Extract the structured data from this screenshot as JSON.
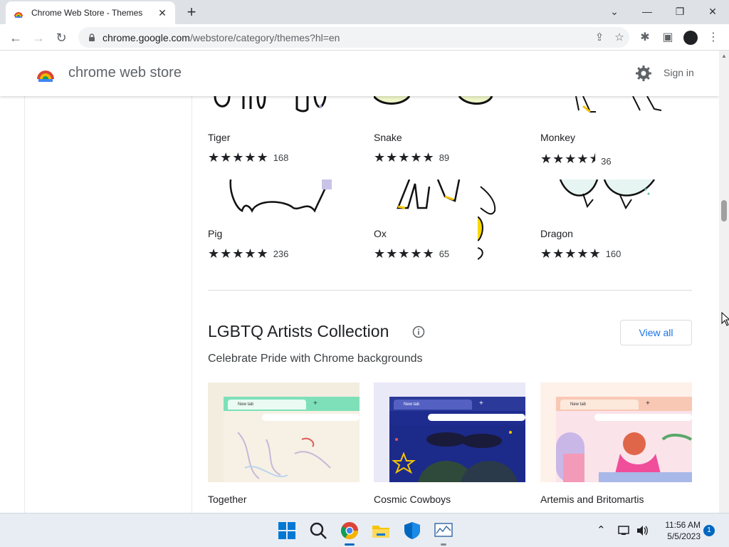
{
  "browser": {
    "tab_title": "Chrome Web Store - Themes",
    "tab_close": "✕",
    "new_tab": "+",
    "url_domain": "chrome.google.com",
    "url_path": "/webstore/category/themes?hl=en",
    "window_controls": {
      "collapse": "⌄",
      "minimize": "—",
      "restore": "❐",
      "close": "✕"
    },
    "nav": {
      "back": "←",
      "forward": "→",
      "reload": "↻"
    },
    "omnibox_icons": {
      "share": "⇪",
      "bookmark": "☆"
    },
    "toolbar_icons": {
      "extensions": "✱",
      "sidepanel": "▣",
      "menu": "⋮"
    }
  },
  "store": {
    "name": "chrome web store",
    "sign_in": "Sign in"
  },
  "zodiac_themes": [
    {
      "name": "Tiger",
      "stars": "★★★★★",
      "rating": 5.0,
      "count": "168"
    },
    {
      "name": "Snake",
      "stars": "★★★★★",
      "rating": 5.0,
      "count": "89"
    },
    {
      "name": "Monkey",
      "stars": "★★★★⯨",
      "rating": 4.5,
      "count": "36"
    },
    {
      "name": "Pig",
      "stars": "★★★★★",
      "rating": 5.0,
      "count": "236"
    },
    {
      "name": "Ox",
      "stars": "★★★★★",
      "rating": 5.0,
      "count": "65"
    },
    {
      "name": "Dragon",
      "stars": "★★★★★",
      "rating": 5.0,
      "count": "160"
    }
  ],
  "collection": {
    "title": "LGBTQ Artists Collection",
    "subtitle": "Celebrate Pride with Chrome backgrounds",
    "view_all": "View all",
    "mini_tab_label": "New tab",
    "cards": [
      {
        "name": "Together",
        "accent": "#7ee0b8",
        "bg": "#f5f1e6"
      },
      {
        "name": "Cosmic Cowboys",
        "accent": "#2b3a9a",
        "bg": "#1c2a8a"
      },
      {
        "name": "Artemis and Britomartis",
        "accent": "#f8c8b4",
        "bg": "#fbe3ea"
      }
    ]
  },
  "taskbar": {
    "time": "11:56 AM",
    "date": "5/5/2023",
    "notifications": "1",
    "tray_chevron": "⌃"
  }
}
